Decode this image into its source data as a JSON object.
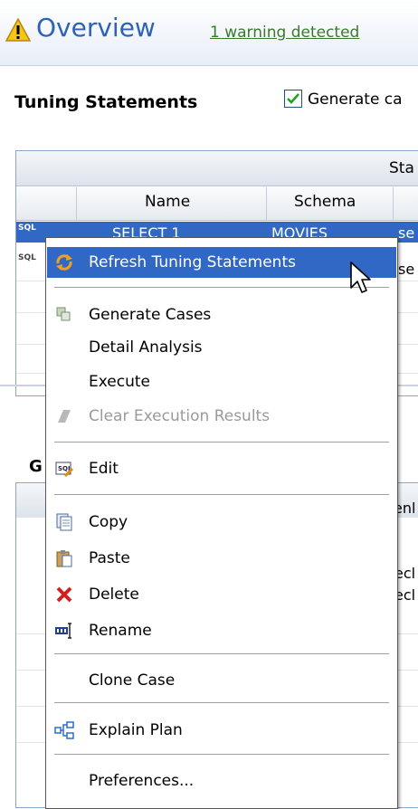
{
  "header": {
    "title": "Overview",
    "warning_link": "1 warning detected"
  },
  "tuning": {
    "title": "Tuning Statements",
    "generate_cases_checkbox_label": "Generate ca",
    "generate_cases_checked": true,
    "table": {
      "group_header": "Sta",
      "columns": [
        "Name",
        "Schema"
      ],
      "rows": [
        {
          "type_badge": "SQL",
          "name": "SELECT 1",
          "schema": "MOVIES",
          "extra": "se",
          "selected": true,
          "checked": true
        },
        {
          "type_badge": "SQL",
          "extra": "se"
        }
      ]
    }
  },
  "lower_section": {
    "label": "G",
    "header_partial": "enl",
    "cell_partials": [
      "ecl",
      "ecl"
    ]
  },
  "context_menu": {
    "items": [
      {
        "label": "Refresh Tuning Statements",
        "icon": "refresh-icon",
        "highlighted": true
      },
      {
        "label": "Generate Cases",
        "icon": "generate-cases-icon"
      },
      {
        "label": "Detail Analysis"
      },
      {
        "label": "Execute"
      },
      {
        "label": "Clear Execution Results",
        "icon": "eraser-icon",
        "disabled": true
      },
      {
        "label": "Edit",
        "icon": "sql-edit-icon"
      },
      {
        "label": "Copy",
        "icon": "copy-icon"
      },
      {
        "label": "Paste",
        "icon": "paste-icon"
      },
      {
        "label": "Delete",
        "icon": "delete-icon"
      },
      {
        "label": "Rename",
        "icon": "rename-icon"
      },
      {
        "label": "Clone Case"
      },
      {
        "label": "Explain Plan",
        "icon": "explain-plan-icon"
      },
      {
        "label": "Preferences..."
      }
    ]
  },
  "colors": {
    "selection": "#3168c5",
    "title_blue": "#2d63b6",
    "warning_link": "#3a7a2a"
  }
}
